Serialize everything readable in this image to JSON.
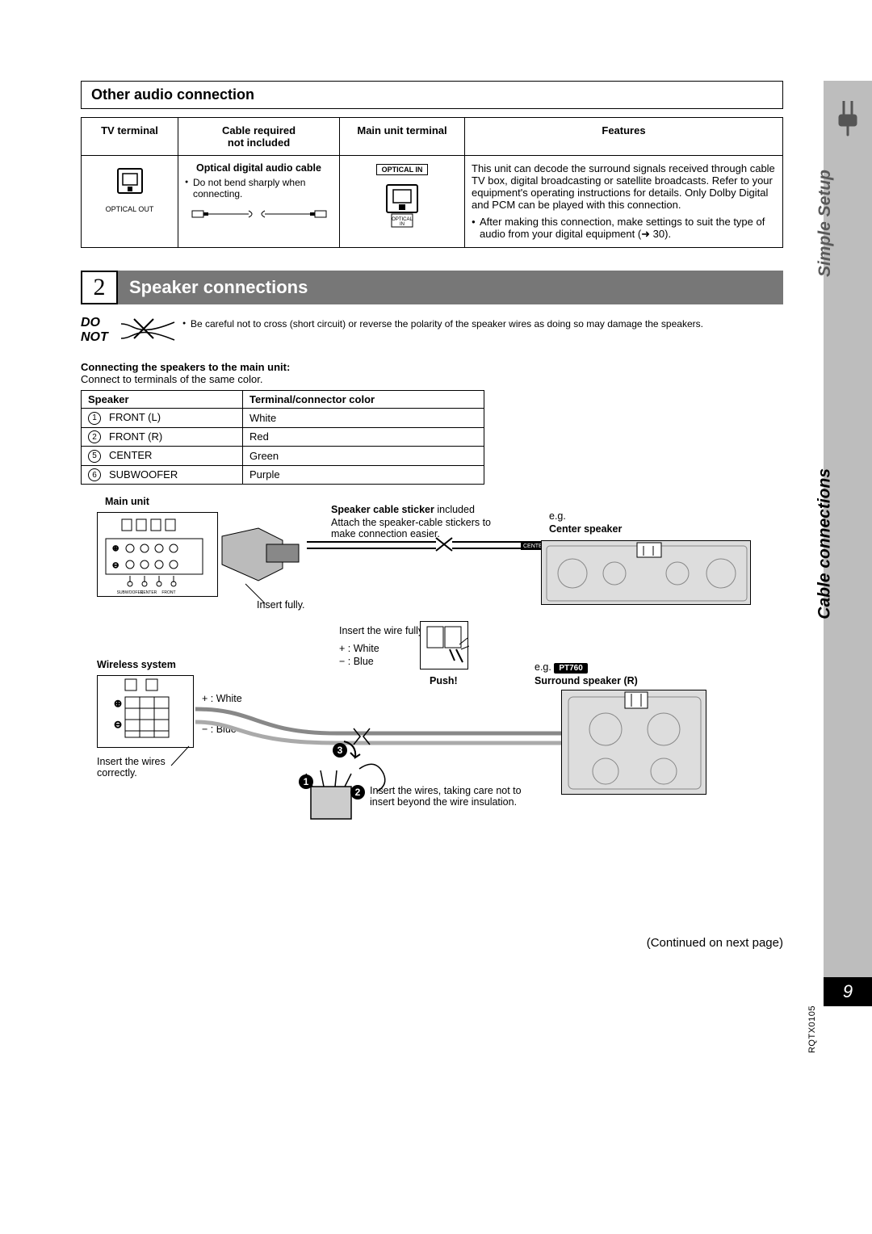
{
  "sidebar": {
    "section1": "Simple Setup",
    "section2": "Cable connections",
    "page_number": "9",
    "manual_code": "RQTX0105"
  },
  "section1": {
    "title": "Other audio connection",
    "headers": {
      "tv": "TV terminal",
      "cable": "Cable required\nnot included",
      "main": "Main unit terminal",
      "features": "Features"
    },
    "row": {
      "tv_label": "OPTICAL OUT",
      "cable_name": "Optical digital audio cable",
      "cable_note": "Do not bend sharply when connecting.",
      "main_badge": "OPTICAL IN",
      "main_port_label": "OPTICAL IN",
      "features_p1": "This unit can decode the surround signals received through cable TV box, digital broadcasting or satellite broadcasts. Refer to your equipment's operating instructions for details. Only Dolby Digital and PCM can be played with this connection.",
      "features_li1": "After making this connection, make settings to suit the type of audio from your digital equipment (➜ 30)."
    }
  },
  "section2": {
    "step_num": "2",
    "step_title": "Speaker connections",
    "donot_label": "DO\nNOT",
    "donot_text": "Be careful not to cross (short circuit) or reverse the polarity of the speaker wires as doing so may damage the speakers.",
    "sub_heading": "Connecting the speakers to the main unit:",
    "sub_text": "Connect to terminals of the same color.",
    "table_headers": {
      "speaker": "Speaker",
      "color": "Terminal/connector color"
    },
    "rows": [
      {
        "n": "1",
        "name": "FRONT (L)",
        "color": "White"
      },
      {
        "n": "2",
        "name": "FRONT (R)",
        "color": "Red"
      },
      {
        "n": "5",
        "name": "CENTER",
        "color": "Green"
      },
      {
        "n": "6",
        "name": "SUBWOOFER",
        "color": "Purple"
      }
    ]
  },
  "diagram": {
    "main_unit": "Main unit",
    "sticker_bold": "Speaker cable sticker",
    "sticker_rest": " included",
    "sticker_note": "Attach the speaker-cable stickers to make connection easier.",
    "eg": "e.g.",
    "center_speaker": "Center speaker",
    "insert_fully": "Insert fully.",
    "wireless": "Wireless system",
    "plus_white": "+ : White",
    "minus_blue": "− : Blue",
    "insert_wire_fully": "Insert the wire fully.",
    "push": "Push!",
    "eg2": "e.g.",
    "model": "PT760",
    "surround_r": "Surround speaker (R)",
    "insert_wires_correctly": "Insert the wires correctly.",
    "step2_text": "Insert the wires, taking care not to insert beyond the wire insulation.",
    "term_labels": {
      "sub": "SUBWOOFER",
      "center": "CENTER",
      "front": "FRONT"
    },
    "sticker_tag": "CENTER",
    "n1": "1",
    "n2": "2",
    "n3": "3"
  },
  "continued": "(Continued on next page)"
}
